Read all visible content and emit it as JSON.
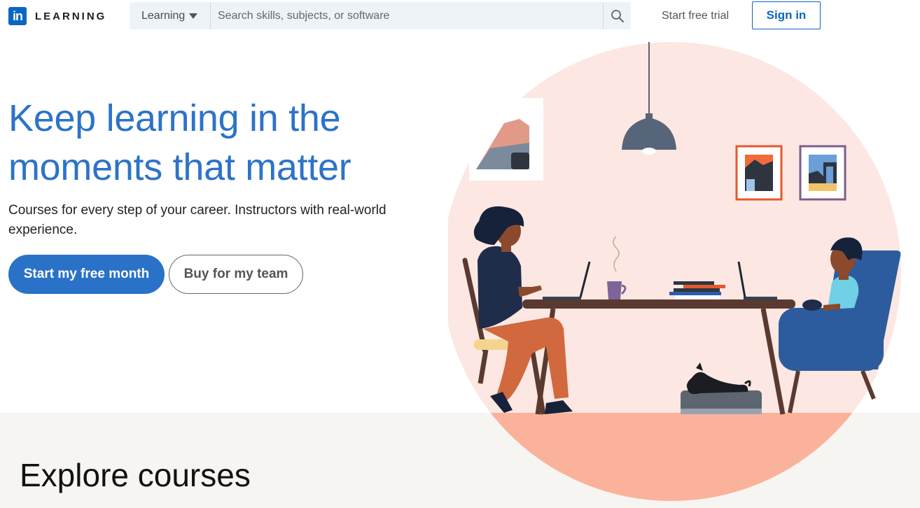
{
  "header": {
    "logo_badge": "in",
    "logo_text": "LEARNING",
    "search_scope": "Learning",
    "search_placeholder": "Search skills, subjects, or software",
    "trial_link": "Start free trial",
    "signin": "Sign in"
  },
  "hero": {
    "title": "Keep learning in the moments that matter",
    "subtitle": "Courses for every step of your career. Instructors with real-world experience.",
    "primary_button": "Start my free month",
    "secondary_button": "Buy for my team"
  },
  "explore": {
    "title": "Explore courses"
  },
  "icons": [
    "linkedin-logo-icon",
    "caret-down-icon",
    "search-icon"
  ],
  "colors": {
    "brand_blue": "#0a66c2",
    "hero_title": "#2d73c8",
    "primary_button": "#2a72c8",
    "circle_pink": "#fde7e2",
    "floor_salmon": "#fbb29b",
    "band": "#f7f5f2"
  }
}
